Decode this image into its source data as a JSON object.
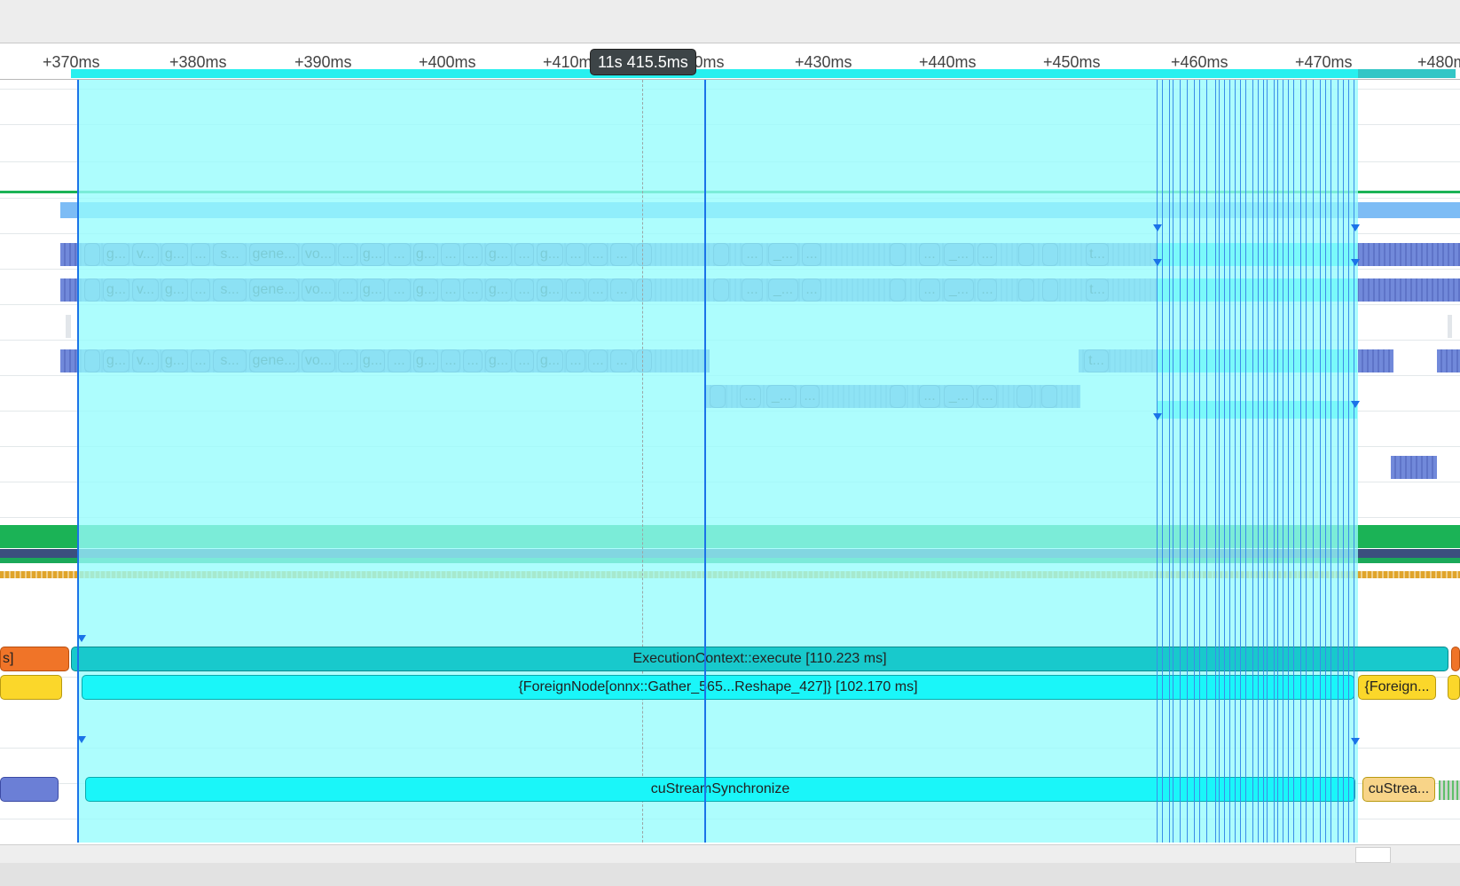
{
  "ruler": {
    "ticks": [
      "+370ms",
      "+380ms",
      "+390ms",
      "+400ms",
      "+410ms",
      "+420ms",
      "+430ms",
      "+440ms",
      "+450ms",
      "+460ms",
      "+470ms",
      "+480ms"
    ],
    "cursor_badge": "11s 415.5ms"
  },
  "kernel_rows": {
    "row_a": [
      "",
      "g...",
      "v...",
      "g...",
      "...",
      "s...",
      "gene...",
      "vo...",
      "...",
      "g...",
      "...",
      "g...",
      "...",
      "...",
      "g...",
      "...",
      "g...",
      "...",
      "...",
      "...",
      ""
    ],
    "row_a_tail": [
      "",
      "...",
      "_...",
      "...",
      "",
      "...",
      "_...",
      "...",
      "",
      "",
      "t..."
    ],
    "row_b": [
      "",
      "g...",
      "v...",
      "g...",
      "...",
      "s...",
      "gene...",
      "vo...",
      "...",
      "g...",
      "...",
      "g...",
      "...",
      "...",
      "g...",
      "...",
      "g...",
      "...",
      "...",
      "...",
      ""
    ],
    "row_c_tail": [
      "",
      "...",
      "_...",
      "...",
      "",
      "...",
      "_...",
      "...",
      "",
      ""
    ],
    "row_c_t": "t..."
  },
  "events": {
    "left_orange_label": "s]",
    "execute_label": "ExecutionContext::execute [110.223 ms]",
    "foreign_node_label": "{ForeignNode[onnx::Gather_565...Reshape_427]} [102.170 ms]",
    "foreign_right_label": "{Foreign...",
    "custream_label": "cuStreamSynchronize",
    "custream_right_label": "cuStrea..."
  },
  "colors": {
    "selection": "#9ffcfc",
    "kernel": "#6b7fd6",
    "execute": "#18c9cc",
    "foreign": "#1af6f9",
    "orange": "#f07428",
    "yellow": "#fbd72a",
    "green": "#1bb356",
    "navy": "#3b4f7e",
    "gold": "#e0a42a",
    "marker_blue": "#1b73e8"
  }
}
